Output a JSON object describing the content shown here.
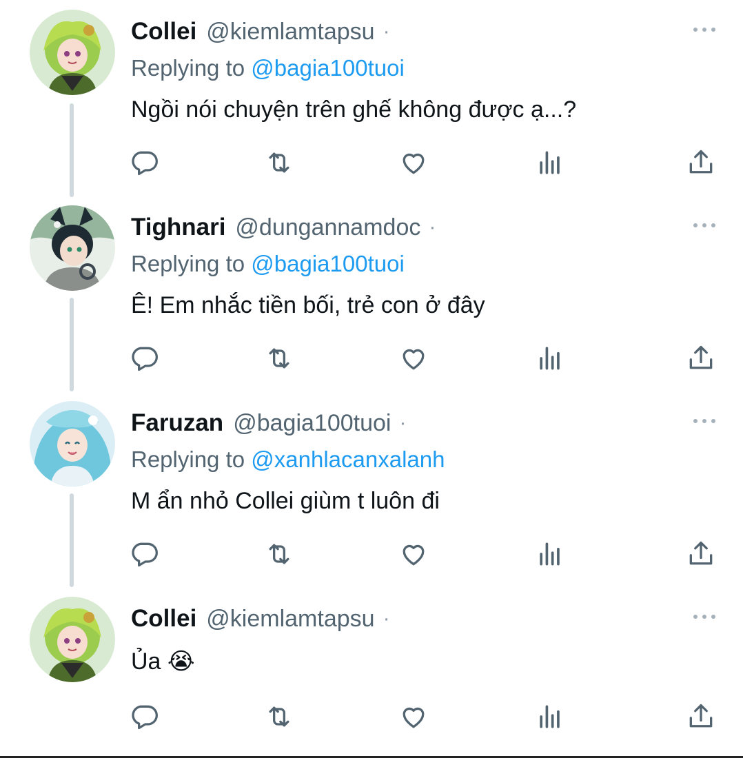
{
  "tweets": [
    {
      "name": "Collei",
      "handle": "@kiemlamtapsu",
      "dot": "·",
      "replying_prefix": "Replying to ",
      "replying_to": "@bagia100tuoi",
      "text": "Ngồi nói chuyện trên ghế không được ạ...?",
      "avatar": "collei-avatar"
    },
    {
      "name": "Tighnari",
      "handle": "@dungannamdoc",
      "dot": "·",
      "replying_prefix": "Replying to ",
      "replying_to": "@bagia100tuoi",
      "text": "Ê! Em nhắc tiền bối, trẻ con ở đây",
      "avatar": "tighnari-avatar"
    },
    {
      "name": "Faruzan",
      "handle": "@bagia100tuoi",
      "dot": "·",
      "replying_prefix": "Replying to ",
      "replying_to": "@xanhlacanxalanh",
      "text": "M ẩn nhỏ Collei giùm t luôn đi",
      "avatar": "faruzan-avatar"
    },
    {
      "name": "Collei",
      "handle": "@kiemlamtapsu",
      "dot": "·",
      "text": "Ủa 😭",
      "avatar": "collei-avatar"
    }
  ],
  "icons": {
    "reply": "reply-icon",
    "retweet": "retweet-icon",
    "like": "like-icon",
    "views": "views-icon",
    "share": "share-icon",
    "more": "more-icon"
  },
  "colors": {
    "text": "#0f1419",
    "secondary": "#536471",
    "mention": "#1d9bf0",
    "thread_line": "#cfd9de",
    "icon": "#536471"
  }
}
